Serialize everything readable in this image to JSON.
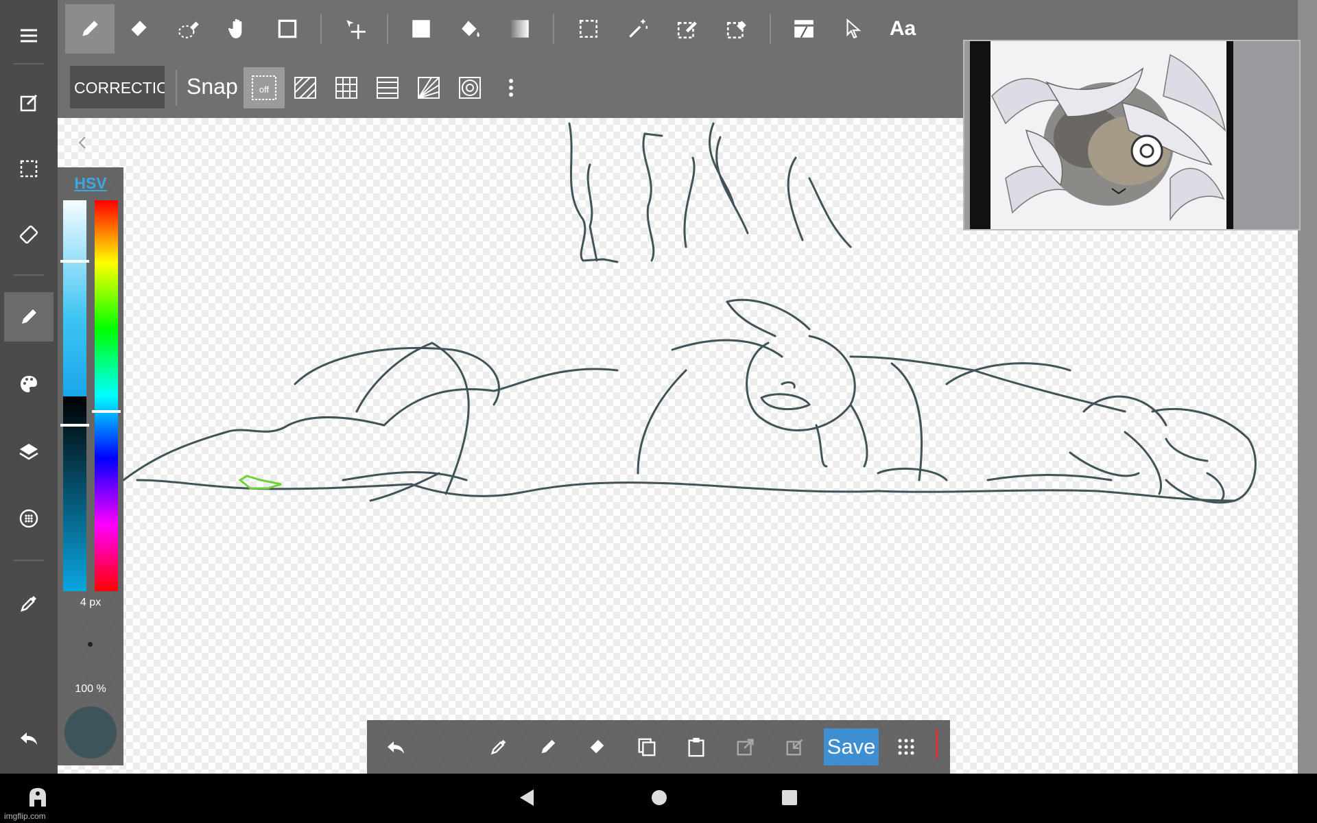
{
  "top_toolbar": {
    "tools": [
      "pen-icon",
      "eraser-icon",
      "blur-icon",
      "hand-icon",
      "rectangle-icon",
      "move-icon",
      "fill-rect-icon",
      "bucket-icon",
      "gradient-icon",
      "select-rect-icon",
      "magic-wand-icon",
      "select-pen-icon",
      "select-eraser-icon",
      "layout-icon",
      "pointer-icon",
      "text-tool"
    ],
    "text_tool_label": "Aa"
  },
  "sub_toolbar": {
    "correction_label": "CORRECTION",
    "snap_label": "Snap",
    "snap_off_label": "off"
  },
  "color_panel": {
    "mode_tab": "HSV",
    "brush_size": "4 px",
    "opacity": "100 %",
    "current_color": "#3d545a"
  },
  "bottom_toolbar": {
    "save_label": "Save"
  },
  "watermark": "imgflip.com"
}
